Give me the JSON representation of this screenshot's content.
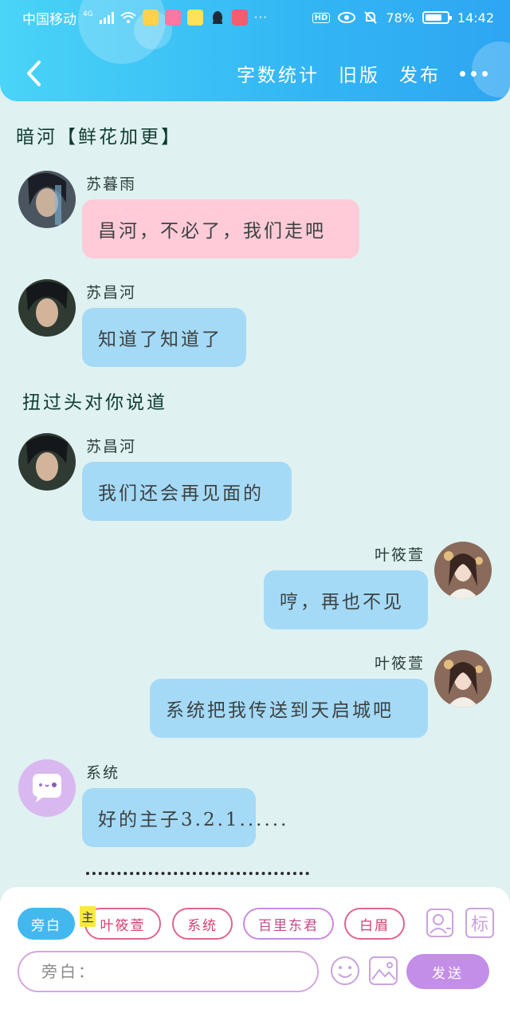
{
  "status_bar": {
    "carrier": "中国移动",
    "network": "4G",
    "hd": "HD",
    "battery": "78%",
    "battery_fraction": 0.78,
    "time": "14:42"
  },
  "nav": {
    "word_count": "字数统计",
    "old_version": "旧版",
    "publish": "发布"
  },
  "narrations": [
    "暗河【鲜花加更】",
    "扭过头对你说道"
  ],
  "messages": [
    {
      "name": "苏暮雨",
      "text": "昌河，不必了，我们走吧",
      "side": "left",
      "color": "pink"
    },
    {
      "name": "苏昌河",
      "text": "知道了知道了",
      "side": "left",
      "color": "blue"
    },
    {
      "name": "苏昌河",
      "text": "我们还会再见面的",
      "side": "left",
      "color": "blue"
    },
    {
      "name": "叶筱萱",
      "text": "哼，再也不见",
      "side": "right",
      "color": "blue"
    },
    {
      "name": "叶筱萱",
      "text": "系统把我传送到天启城吧",
      "side": "right",
      "color": "blue"
    },
    {
      "name": "系统",
      "text": "好的主子3.2.1......",
      "side": "left",
      "color": "blue"
    }
  ],
  "composer": {
    "roles": [
      "旁白",
      "叶筱萱",
      "系统",
      "百里东君",
      "白眉"
    ],
    "main_tag": "主",
    "mark_label": "标",
    "input_placeholder": "旁白：",
    "send": "发送"
  },
  "colors": {
    "header": "#33b6f4",
    "background": "#dff1f1",
    "bubble_blue": "#a5daf7",
    "bubble_pink": "#ffcbd8",
    "send_button": "#c38ee8"
  }
}
